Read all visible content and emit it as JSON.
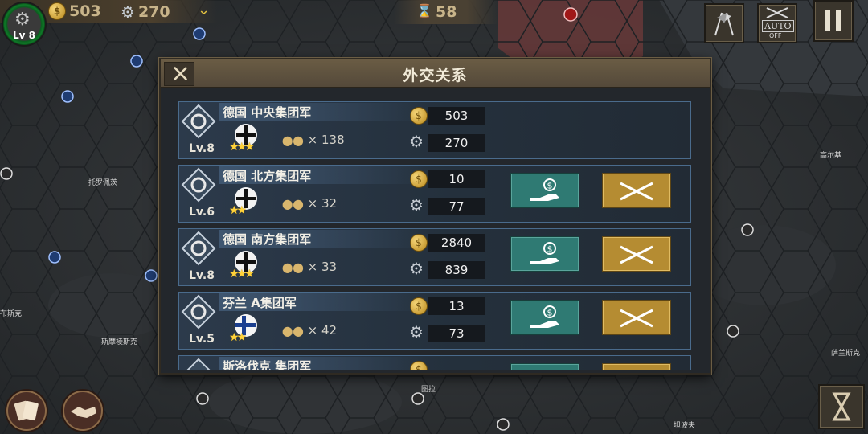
{
  "hud": {
    "level": "Lv 8",
    "gold": "503",
    "industry": "270",
    "turn": "58",
    "auto_label": "AUTO",
    "auto_state": "OFF"
  },
  "map_labels": [
    "托罗佩茨",
    "高尔基",
    "布斯克",
    "斯摩棱斯克",
    "萨兰斯克",
    "图拉",
    "坦波夫"
  ],
  "dialog": {
    "title": "外交关系",
    "rows": [
      {
        "name": "德国 中央集团军",
        "level": "Lv.8",
        "units": "× 138",
        "gold": "503",
        "industry": "270",
        "stars": 3,
        "flag": "germany",
        "actions": false
      },
      {
        "name": "德国 北方集团军",
        "level": "Lv.6",
        "units": "× 32",
        "gold": "10",
        "industry": "77",
        "stars": 2,
        "flag": "germany",
        "actions": true
      },
      {
        "name": "德国 南方集团军",
        "level": "Lv.8",
        "units": "× 33",
        "gold": "2840",
        "industry": "839",
        "stars": 3,
        "flag": "germany",
        "actions": true
      },
      {
        "name": "芬兰 A集团军",
        "level": "Lv.5",
        "units": "× 42",
        "gold": "13",
        "industry": "73",
        "stars": 2,
        "flag": "finland",
        "actions": true
      },
      {
        "name": "斯洛伐克 集团军",
        "level": "",
        "units": "",
        "gold": "",
        "industry": "",
        "stars": 0,
        "flag": "slovakia",
        "actions": true
      }
    ]
  },
  "colors": {
    "bribe": "#2f7a73",
    "attack": "#b58c32",
    "row_border": "#4a6b8c"
  }
}
